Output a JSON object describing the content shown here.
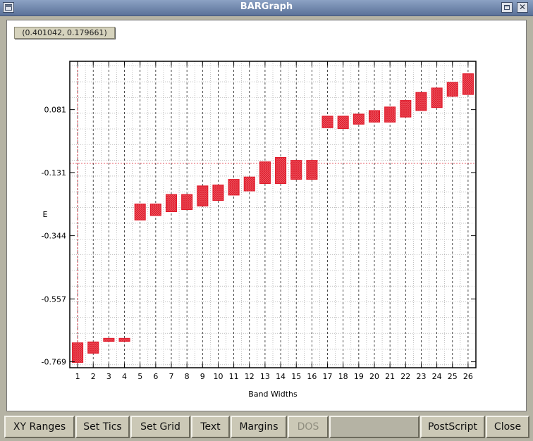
{
  "window": {
    "title": "BARGraph"
  },
  "coordinate_readout": "(0.401042, 0.179661)",
  "buttons": [
    {
      "label": "XY Ranges",
      "name": "xy-ranges-button",
      "enabled": true
    },
    {
      "label": "Set Tics",
      "name": "set-tics-button",
      "enabled": true
    },
    {
      "label": "Set Grid",
      "name": "set-grid-button",
      "enabled": true
    },
    {
      "label": "Text",
      "name": "text-button",
      "enabled": true
    },
    {
      "label": "Margins",
      "name": "margins-button",
      "enabled": true
    },
    {
      "label": "DOS",
      "name": "dos-button",
      "enabled": false
    },
    {
      "label": "",
      "name": "blank-button",
      "enabled": true
    },
    {
      "label": "PostScript",
      "name": "postscript-button",
      "enabled": true
    },
    {
      "label": "Close",
      "name": "close-button",
      "enabled": true
    }
  ],
  "chart_data": {
    "type": "bar",
    "xlabel": "Band Widths",
    "ylabel": "E",
    "categories": [
      "1",
      "2",
      "3",
      "4",
      "5",
      "6",
      "7",
      "8",
      "9",
      "10",
      "11",
      "12",
      "13",
      "14",
      "15",
      "16",
      "17",
      "18",
      "19",
      "20",
      "21",
      "22",
      "23",
      "24",
      "25",
      "26"
    ],
    "yticks": [
      "0.081",
      "-0.131",
      "-0.344",
      "-0.557",
      "-0.769"
    ],
    "ytick_values": [
      0.081,
      -0.131,
      -0.344,
      -0.557,
      -0.769
    ],
    "ylim": [
      -0.789,
      0.244
    ],
    "xlim": [
      0.5,
      26.5
    ],
    "bars": [
      {
        "x": 1,
        "low": -0.771,
        "high": -0.705
      },
      {
        "x": 2,
        "low": -0.74,
        "high": -0.702
      },
      {
        "x": 3,
        "low": -0.7,
        "high": -0.69
      },
      {
        "x": 4,
        "low": -0.7,
        "high": -0.69
      },
      {
        "x": 5,
        "low": -0.291,
        "high": -0.237
      },
      {
        "x": 6,
        "low": -0.276,
        "high": -0.237
      },
      {
        "x": 7,
        "low": -0.263,
        "high": -0.205
      },
      {
        "x": 8,
        "low": -0.256,
        "high": -0.205
      },
      {
        "x": 9,
        "low": -0.244,
        "high": -0.176
      },
      {
        "x": 10,
        "low": -0.225,
        "high": -0.173
      },
      {
        "x": 11,
        "low": -0.207,
        "high": -0.154
      },
      {
        "x": 12,
        "low": -0.193,
        "high": -0.146
      },
      {
        "x": 13,
        "low": -0.168,
        "high": -0.095
      },
      {
        "x": 14,
        "low": -0.168,
        "high": -0.08
      },
      {
        "x": 15,
        "low": -0.154,
        "high": -0.09
      },
      {
        "x": 16,
        "low": -0.154,
        "high": -0.09
      },
      {
        "x": 17,
        "low": 0.02,
        "high": 0.059
      },
      {
        "x": 18,
        "low": 0.017,
        "high": 0.059
      },
      {
        "x": 19,
        "low": 0.032,
        "high": 0.066
      },
      {
        "x": 20,
        "low": 0.039,
        "high": 0.078
      },
      {
        "x": 21,
        "low": 0.039,
        "high": 0.09
      },
      {
        "x": 22,
        "low": 0.056,
        "high": 0.112
      },
      {
        "x": 23,
        "low": 0.078,
        "high": 0.139
      },
      {
        "x": 24,
        "low": 0.088,
        "high": 0.154
      },
      {
        "x": 25,
        "low": 0.126,
        "high": 0.173
      },
      {
        "x": 26,
        "low": 0.132,
        "high": 0.202
      }
    ],
    "bar_color": "#e01a2a",
    "grid": true,
    "crosshair": {
      "x": 1.0,
      "y": -0.1
    }
  }
}
